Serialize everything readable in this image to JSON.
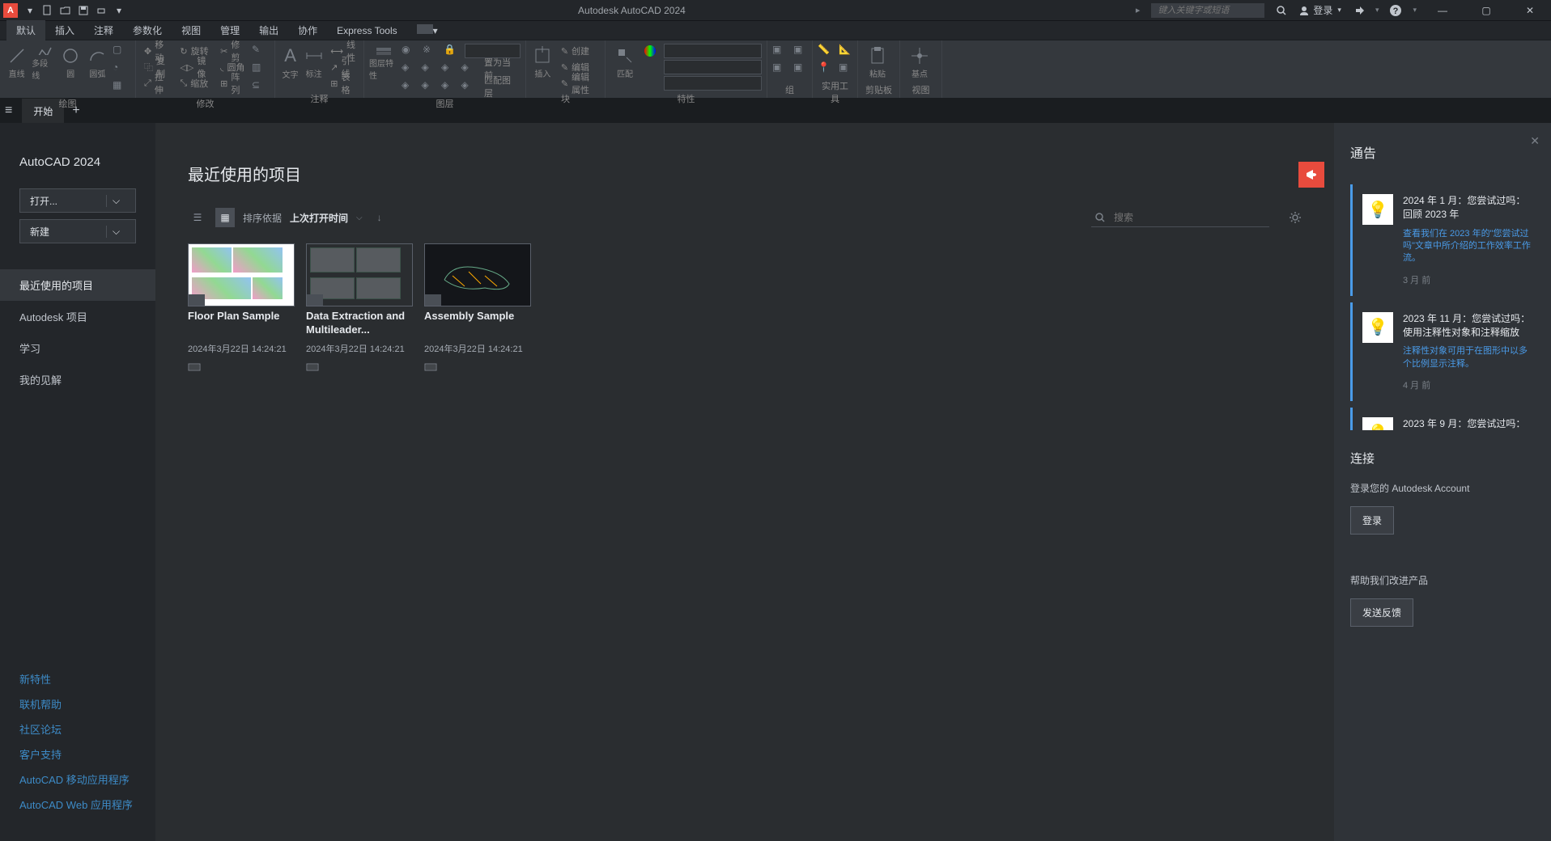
{
  "titlebar": {
    "app_title": "Autodesk AutoCAD 2024",
    "search_placeholder": "键入关键字或短语",
    "login_label": "登录"
  },
  "menubar": {
    "items": [
      "默认",
      "插入",
      "注释",
      "参数化",
      "视图",
      "管理",
      "输出",
      "协作",
      "Express Tools"
    ]
  },
  "ribbon": {
    "panels": [
      {
        "label": "绘图",
        "items": [
          "直线",
          "多段线",
          "圆",
          "圆弧"
        ]
      },
      {
        "label": "修改",
        "items": [
          "移动",
          "复制",
          "拉伸",
          "旋转",
          "镜像",
          "缩放",
          "修剪",
          "圆角",
          "阵列"
        ]
      },
      {
        "label": "注释",
        "items": [
          "文字",
          "标注",
          "线性",
          "引线",
          "表格"
        ]
      },
      {
        "label": "图层",
        "items": [
          "图层特性",
          "置为当前",
          "匹配图层"
        ]
      },
      {
        "label": "块",
        "items": [
          "插入",
          "创建",
          "编辑",
          "编辑属性"
        ]
      },
      {
        "label": "特性",
        "items": [
          "匹配",
          "特性"
        ]
      },
      {
        "label": "组",
        "items": []
      },
      {
        "label": "实用工具",
        "items": []
      },
      {
        "label": "剪贴板",
        "items": [
          "粘贴"
        ]
      },
      {
        "label": "视图",
        "items": [
          "基点"
        ]
      }
    ]
  },
  "tab": {
    "start": "开始"
  },
  "sidebar": {
    "title": "AutoCAD 2024",
    "open_label": "打开...",
    "new_label": "新建",
    "nav": [
      {
        "label": "最近使用的项目",
        "active": true
      },
      {
        "label": "Autodesk 项目",
        "active": false
      },
      {
        "label": "学习",
        "active": false
      },
      {
        "label": "我的见解",
        "active": false
      }
    ],
    "links": [
      "新特性",
      "联机帮助",
      "社区论坛",
      "客户支持",
      "AutoCAD 移动应用程序",
      "AutoCAD Web 应用程序"
    ]
  },
  "content": {
    "title": "最近使用的项目",
    "sort_label": "排序依据",
    "sort_value": "上次打开时间",
    "search_placeholder": "搜索",
    "projects": [
      {
        "name": "Floor Plan Sample",
        "date": "2024年3月22日 14:24:21"
      },
      {
        "name": "Data Extraction and Multileader...",
        "date": "2024年3月22日 14:24:21"
      },
      {
        "name": "Assembly Sample",
        "date": "2024年3月22日 14:24:21"
      }
    ]
  },
  "right_panel": {
    "title": "通告",
    "notifications": [
      {
        "title": "2024 年 1 月：您尝试过吗：回顾 2023 年",
        "desc": "查看我们在 2023 年的\"您尝试过吗\"文章中所介绍的工作效率工作流。",
        "time": "3 月 前"
      },
      {
        "title": "2023 年 11 月：您尝试过吗：使用注释性对象和注释缩放",
        "desc": "注释性对象可用于在图形中以多个比例显示注释。",
        "time": "4 月 前"
      },
      {
        "title": "2023 年 9 月：您尝试过吗：",
        "desc": "",
        "time": ""
      }
    ],
    "connect_title": "连接",
    "connect_desc": "登录您的 Autodesk Account",
    "login_btn": "登录",
    "help_title": "帮助我们改进产品",
    "feedback_btn": "发送反馈"
  }
}
